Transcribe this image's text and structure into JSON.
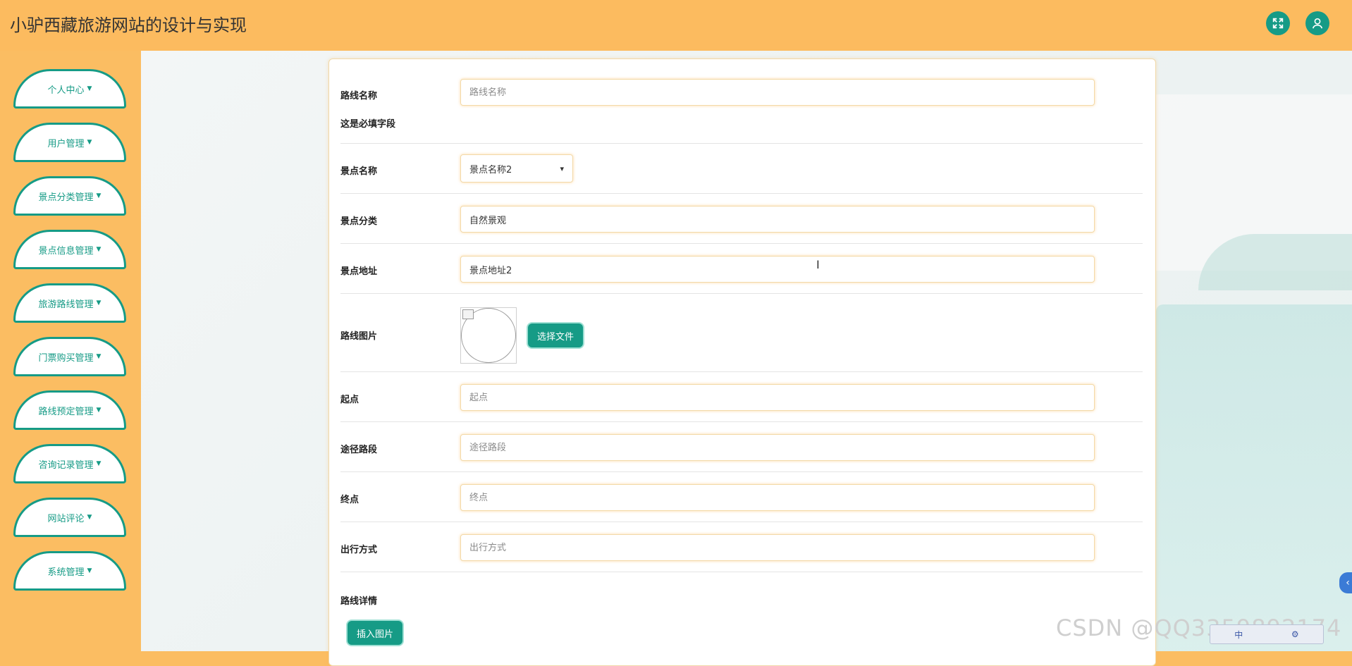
{
  "header": {
    "title": "小驴西藏旅游网站的设计与实现",
    "fullscreen_icon": "fullscreen-icon",
    "user_icon": "user-icon"
  },
  "sidebar": {
    "items": [
      {
        "label": "个人中心"
      },
      {
        "label": "用户管理"
      },
      {
        "label": "景点分类管理"
      },
      {
        "label": "景点信息管理"
      },
      {
        "label": "旅游路线管理"
      },
      {
        "label": "门票购买管理"
      },
      {
        "label": "路线预定管理"
      },
      {
        "label": "咨询记录管理"
      },
      {
        "label": "网站评论"
      },
      {
        "label": "系统管理"
      }
    ]
  },
  "form": {
    "route_name": {
      "label": "路线名称",
      "placeholder": "路线名称",
      "value": "",
      "error": "这是必填字段"
    },
    "spot_name": {
      "label": "景点名称",
      "selected": "景点名称2"
    },
    "spot_category": {
      "label": "景点分类",
      "value": "自然景观"
    },
    "spot_address": {
      "label": "景点地址",
      "value": "景点地址2"
    },
    "route_image": {
      "label": "路线图片",
      "button": "选择文件"
    },
    "start": {
      "label": "起点",
      "placeholder": "起点",
      "value": ""
    },
    "via": {
      "label": "途径路段",
      "placeholder": "途径路段",
      "value": ""
    },
    "end": {
      "label": "终点",
      "placeholder": "终点",
      "value": ""
    },
    "travel_mode": {
      "label": "出行方式",
      "placeholder": "出行方式",
      "value": ""
    },
    "details": {
      "label": "路线详情",
      "button": "插入图片"
    }
  },
  "overlay": {
    "watermark": "CSDN @QQ3359892174",
    "ime": "中"
  },
  "colors": {
    "primary": "#169b86",
    "header_bg": "#fcbb5f",
    "field_glow": "#fbbd62"
  }
}
